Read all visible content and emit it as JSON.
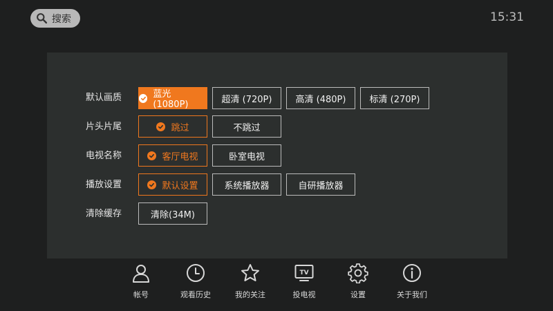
{
  "topbar": {
    "search_label": "搜索",
    "time": "15:31"
  },
  "settings": {
    "rows": [
      {
        "label": "默认画质",
        "options": [
          {
            "label": "蓝光 (1080P)",
            "selected": true,
            "focused": true
          },
          {
            "label": "超清 (720P)",
            "selected": false
          },
          {
            "label": "高清 (480P)",
            "selected": false
          },
          {
            "label": "标清 (270P)",
            "selected": false
          }
        ]
      },
      {
        "label": "片头片尾",
        "options": [
          {
            "label": "跳过",
            "selected": true
          },
          {
            "label": "不跳过",
            "selected": false
          }
        ]
      },
      {
        "label": "电视名称",
        "options": [
          {
            "label": "客厅电视",
            "selected": true
          },
          {
            "label": "卧室电视",
            "selected": false
          }
        ]
      },
      {
        "label": "播放设置",
        "options": [
          {
            "label": "默认设置",
            "selected": true
          },
          {
            "label": "系统播放器",
            "selected": false
          },
          {
            "label": "自研播放器",
            "selected": false
          }
        ]
      },
      {
        "label": "清除缓存",
        "options": [
          {
            "label": "清除(34M)",
            "selected": false
          }
        ]
      }
    ]
  },
  "bottom_nav": [
    {
      "label": "帐号",
      "icon": "person-icon"
    },
    {
      "label": "观看历史",
      "icon": "clock-icon"
    },
    {
      "label": "我的关注",
      "icon": "star-icon"
    },
    {
      "label": "投电视",
      "icon": "tv-icon"
    },
    {
      "label": "设置",
      "icon": "gear-icon"
    },
    {
      "label": "关于我们",
      "icon": "info-icon"
    }
  ],
  "colors": {
    "accent": "#f0781e",
    "background": "#1e1f1f",
    "panel": "#2c2f2e"
  }
}
